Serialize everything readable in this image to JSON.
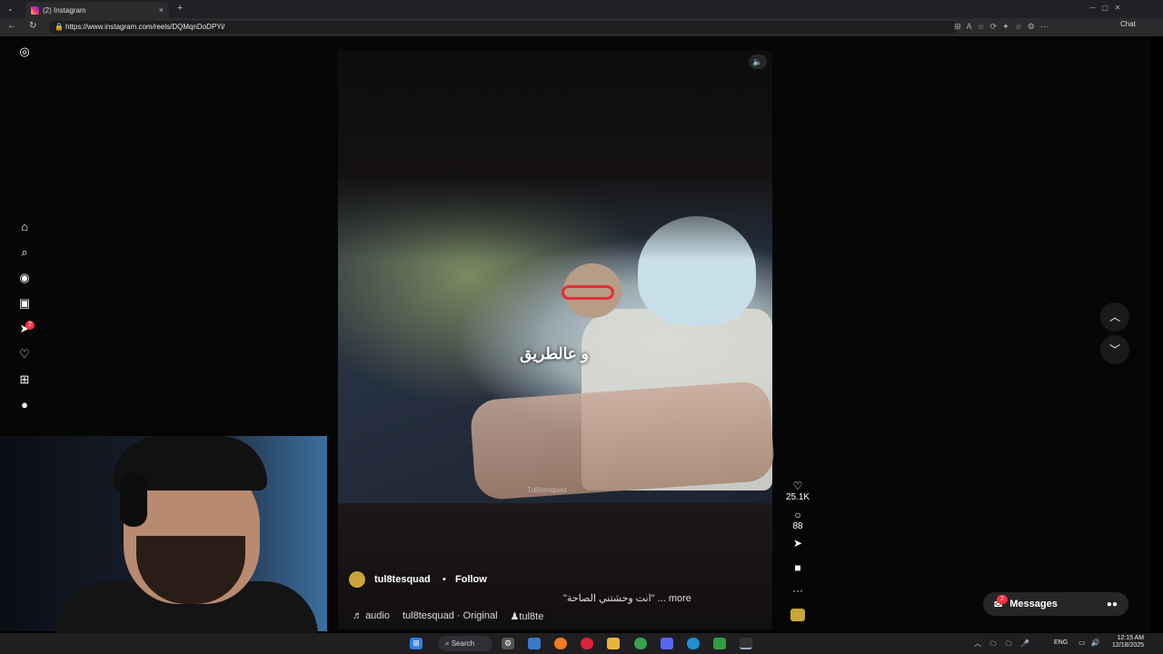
{
  "browser": {
    "tab_title": "(2) Instagram",
    "tab_close": "×",
    "new_tab": "+",
    "url": "https://www.instagram.com/reels/DQMqnDoDPYi/",
    "chat_label": "Chat",
    "back": "←",
    "refresh": "↻"
  },
  "sidebar": {
    "items": [
      {
        "name": "instagram-logo-icon",
        "glyph": "◎"
      },
      {
        "name": "home-icon",
        "glyph": "⌂"
      },
      {
        "name": "search-icon",
        "glyph": "⌕"
      },
      {
        "name": "explore-icon",
        "glyph": "◉"
      },
      {
        "name": "reels-icon",
        "glyph": "▣"
      },
      {
        "name": "messages-icon",
        "glyph": "➤"
      },
      {
        "name": "notifications-icon",
        "glyph": "♡"
      },
      {
        "name": "create-icon",
        "glyph": "⊞"
      },
      {
        "name": "profile-icon",
        "glyph": "●"
      }
    ],
    "messages_badge": "2"
  },
  "reel": {
    "subtitle": "و عالطريق",
    "watermark": "Tul8tesquad",
    "mute_glyph": "🔈",
    "likes": "25.1K",
    "comments": "88",
    "like_glyph": "♡",
    "comment_glyph": "○",
    "share_glyph": "➤",
    "save_glyph": "■",
    "more_glyph": "···",
    "username": "tul8tesquad",
    "separator": "•",
    "follow": "Follow",
    "caption": "\"انت وحشتني الصاحة\" ... more",
    "audio_label": "audio",
    "audio_source": "tul8tesquad · Original",
    "tagged": "tul8te",
    "audio_glyph": "♬",
    "tag_glyph": "♟"
  },
  "nav": {
    "up": "︿",
    "down": "﹀"
  },
  "messages": {
    "label": "Messages",
    "badge": "2"
  },
  "taskbar": {
    "search": "Search",
    "language": "ENG",
    "time": "12:15 AM",
    "date": "12/18/2025"
  }
}
